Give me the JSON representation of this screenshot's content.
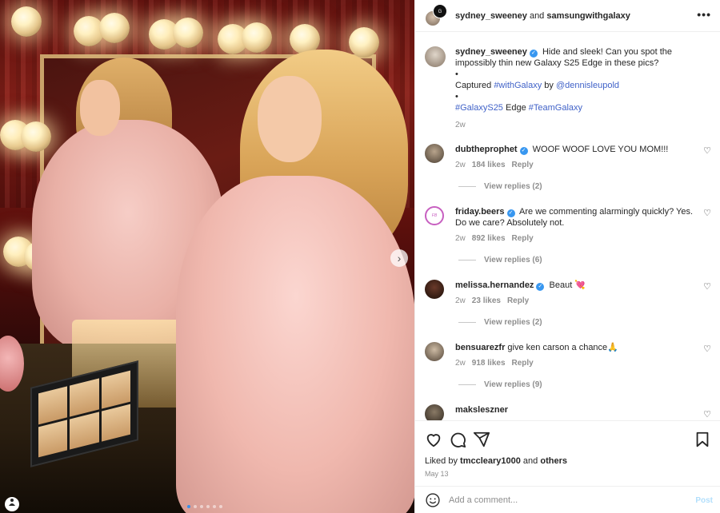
{
  "header": {
    "user1": "sydney_sweeney",
    "connector": " and ",
    "user2": "samsungwithgalaxy",
    "more": "•••"
  },
  "media": {
    "next": "›",
    "carousel_total": 6,
    "carousel_active": 1
  },
  "caption": {
    "username": "sydney_sweeney",
    "text": "Hide and sleek! Can you spot the impossibly thin new Galaxy S25 Edge in these pics?",
    "bullet1": "•",
    "captured_prefix": "Captured ",
    "captured_tag": "#withGalaxy",
    "captured_by": " by ",
    "captured_user": "@dennisleupold",
    "bullet2": "•",
    "hashtag1": "#GalaxyS25",
    "hashtag_mid": " Edge ",
    "hashtag2": "#TeamGalaxy",
    "time": "2w"
  },
  "comments": [
    {
      "username": "dubtheprophet",
      "verified": true,
      "text": "WOOF WOOF LOVE YOU MOM!!!",
      "time": "2w",
      "likes": "184 likes",
      "reply": "Reply",
      "view_replies": "View replies (2)"
    },
    {
      "username": "friday.beers",
      "verified": true,
      "text": "Are we commenting alarmingly quickly? Yes. Do we care? Absolutely not.",
      "time": "2w",
      "likes": "892 likes",
      "reply": "Reply",
      "view_replies": "View replies (6)"
    },
    {
      "username": "melissa.hernandez",
      "verified": true,
      "text": "Beaut 💘",
      "time": "2w",
      "likes": "23 likes",
      "reply": "Reply",
      "view_replies": "View replies (2)"
    },
    {
      "username": "bensuarezfr",
      "verified": false,
      "text": "give ken carson a chance🙏",
      "time": "2w",
      "likes": "918 likes",
      "reply": "Reply",
      "view_replies": "View replies (9)"
    },
    {
      "username": "maksleszner",
      "verified": false,
      "text": ""
    }
  ],
  "footer": {
    "liked_prefix": "Liked by ",
    "liked_user": "tmccleary1000",
    "liked_mid": " and ",
    "liked_others": "others",
    "date": "May 13",
    "comment_placeholder": "Add a comment...",
    "post": "Post"
  },
  "colors": {
    "link": "#4062c8",
    "verified": "#3897f0",
    "muted": "#8e8e8e",
    "post_disabled": "#b2dffc"
  },
  "icons": [
    "heart-icon",
    "comment-icon",
    "share-icon",
    "bookmark-icon",
    "smiley-icon",
    "more-icon",
    "chevron-right-icon"
  ]
}
